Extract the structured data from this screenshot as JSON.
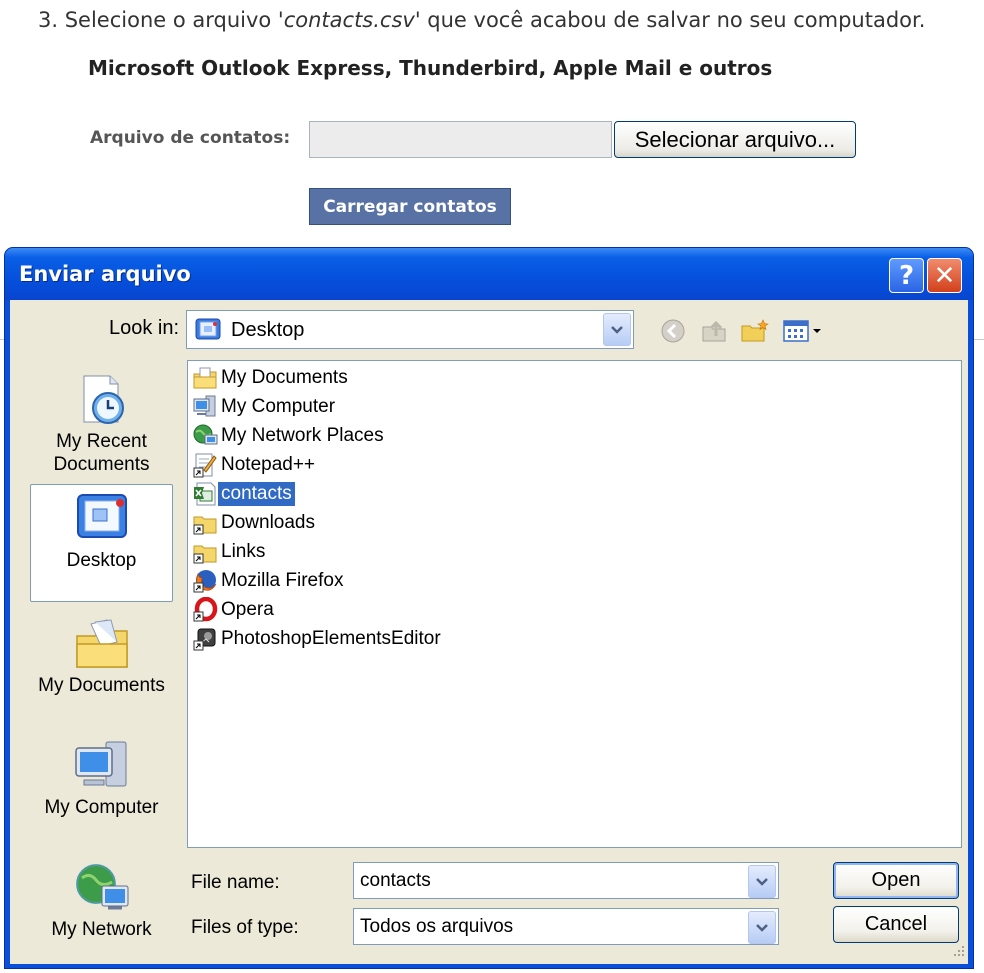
{
  "web": {
    "step_prefix": "3. Selecione o arquivo '",
    "step_file": "contacts.csv",
    "step_suffix": "' que você acabou de salvar no seu computador.",
    "subtitle": "Microsoft Outlook Express, Thunderbird, Apple Mail e outros",
    "file_label": "Arquivo de contatos:",
    "file_value": "",
    "select_button": "Selecionar arquivo...",
    "upload_button": "Carregar contatos"
  },
  "dialog": {
    "title": "Enviar arquivo",
    "help_glyph": "?",
    "close_glyph": "✕",
    "look_in_label": "Look in:",
    "look_in_value": "Desktop",
    "toolbar_icons": [
      "back-icon",
      "up-folder-icon",
      "new-folder-icon",
      "views-menu-icon"
    ],
    "places": [
      {
        "label": "My Recent\nDocuments",
        "icon": "recent-documents-icon",
        "selected": false
      },
      {
        "label": "Desktop",
        "icon": "desktop-icon",
        "selected": true
      },
      {
        "label": "My Documents",
        "icon": "my-documents-icon",
        "selected": false
      },
      {
        "label": "My Computer",
        "icon": "my-computer-icon",
        "selected": false
      },
      {
        "label": "My Network",
        "icon": "my-network-icon",
        "selected": false
      }
    ],
    "files": [
      {
        "name": "My Documents",
        "icon": "my-documents-icon",
        "selected": false
      },
      {
        "name": "My Computer",
        "icon": "my-computer-icon",
        "selected": false
      },
      {
        "name": "My Network Places",
        "icon": "network-places-icon",
        "selected": false
      },
      {
        "name": "Notepad++",
        "icon": "notepad-shortcut-icon",
        "selected": false
      },
      {
        "name": "contacts",
        "icon": "excel-csv-icon",
        "selected": true
      },
      {
        "name": "Downloads",
        "icon": "folder-shortcut-icon",
        "selected": false
      },
      {
        "name": "Links",
        "icon": "folder-shortcut-icon",
        "selected": false
      },
      {
        "name": "Mozilla Firefox",
        "icon": "firefox-icon",
        "selected": false
      },
      {
        "name": "Opera",
        "icon": "opera-icon",
        "selected": false
      },
      {
        "name": "PhotoshopElementsEditor",
        "icon": "photoshop-shortcut-icon",
        "selected": false
      }
    ],
    "file_name_label": "File name:",
    "file_name_value": "contacts",
    "file_type_label": "Files of type:",
    "file_type_value": "Todos os arquivos",
    "open_button": "Open",
    "cancel_button": "Cancel"
  },
  "colors": {
    "titlebar": "#0550dc",
    "selection": "#316ac5",
    "dialog_face": "#ece9d8",
    "web_button": "#5872a6"
  }
}
